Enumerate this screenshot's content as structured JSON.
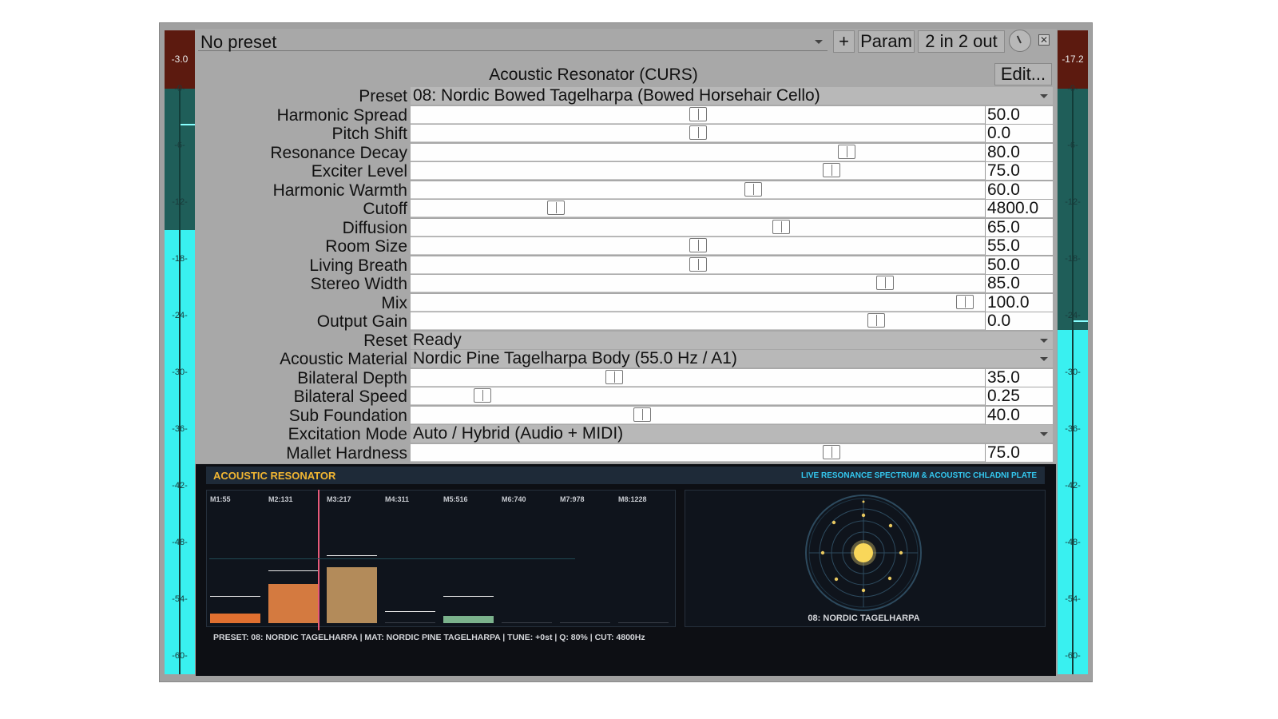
{
  "topbar": {
    "preset_selector": "No preset",
    "add_label": "+",
    "param_label": "Param",
    "io_label": "2 in 2 out",
    "close_icon": "close-icon",
    "knob_icon": "dial-icon"
  },
  "plugin": {
    "title": "Acoustic Resonator (CURS)",
    "edit_label": "Edit..."
  },
  "meters": {
    "left_peak": "-3.0",
    "right_peak": "-17.2",
    "scale": [
      "-0-",
      "-6-",
      "-12-",
      "-18-",
      "-24-",
      "-30-",
      "-36-",
      "-42-",
      "-48-",
      "-54-",
      "-60-"
    ],
    "left_level": 0.69,
    "right_level": 0.535,
    "left_hold": 0.855,
    "right_hold": 0.55,
    "fill_color": "#39f0f0",
    "dark_color": "#1f5e59",
    "clip_color": "#5c1a0f"
  },
  "params": [
    {
      "type": "combo",
      "label": "Preset",
      "value": "08: Nordic Bowed Tagelharpa (Bowed Horsehair Cello)"
    },
    {
      "type": "slider",
      "label": "Harmonic Spread",
      "value": "50.0",
      "pos": 0.5
    },
    {
      "type": "slider",
      "label": "Pitch Shift",
      "value": "0.0",
      "pos": 0.5
    },
    {
      "type": "slider",
      "label": "Resonance Decay",
      "value": "80.0",
      "pos": 0.767
    },
    {
      "type": "slider",
      "label": "Exciter Level",
      "value": "75.0",
      "pos": 0.741
    },
    {
      "type": "slider",
      "label": "Harmonic Warmth",
      "value": "60.0",
      "pos": 0.6
    },
    {
      "type": "slider",
      "label": "Cutoff",
      "value": "4800.0",
      "pos": 0.246
    },
    {
      "type": "slider",
      "label": "Diffusion",
      "value": "65.0",
      "pos": 0.65
    },
    {
      "type": "slider",
      "label": "Room Size",
      "value": "55.0",
      "pos": 0.5
    },
    {
      "type": "slider",
      "label": "Living Breath",
      "value": "50.0",
      "pos": 0.5
    },
    {
      "type": "slider",
      "label": "Stereo Width",
      "value": "85.0",
      "pos": 0.836
    },
    {
      "type": "slider",
      "label": "Mix",
      "value": "100.0",
      "pos": 0.98
    },
    {
      "type": "slider",
      "label": "Output Gain",
      "value": "0.0",
      "pos": 0.82
    },
    {
      "type": "combo",
      "label": "Reset",
      "value": "Ready"
    },
    {
      "type": "combo",
      "label": "Acoustic Material",
      "value": "Nordic Pine Tagelharpa Body (55.0 Hz / A1)"
    },
    {
      "type": "slider",
      "label": "Bilateral Depth",
      "value": "35.0",
      "pos": 0.35
    },
    {
      "type": "slider",
      "label": "Bilateral Speed",
      "value": "0.25",
      "pos": 0.114
    },
    {
      "type": "slider",
      "label": "Sub Foundation",
      "value": "40.0",
      "pos": 0.4
    },
    {
      "type": "combo",
      "label": "Excitation Mode",
      "value": "Auto / Hybrid (Audio + MIDI)"
    },
    {
      "type": "slider",
      "label": "Mallet Hardness",
      "value": "75.0",
      "pos": 0.741
    }
  ],
  "viz": {
    "title": "ACOUSTIC RESONATOR",
    "subtitle": "LIVE RESONANCE SPECTRUM & ACOUSTIC CHLADNI PLATE",
    "modes": [
      {
        "label": "M1:55",
        "level": 0.07,
        "peak": 0.2,
        "color": "#e07030"
      },
      {
        "label": "M2:131",
        "level": 0.29,
        "peak": 0.39,
        "color": "#d47a40"
      },
      {
        "label": "M3:217",
        "level": 0.41,
        "peak": 0.5,
        "color": "#b38b5a"
      },
      {
        "label": "M4:311",
        "level": 0.0,
        "peak": 0.09,
        "color": "#7a7a7a"
      },
      {
        "label": "M5:516",
        "level": 0.05,
        "peak": 0.2,
        "color": "#7bb28c"
      },
      {
        "label": "M6:740",
        "level": 0.0,
        "peak": 0.0,
        "color": "#7a7a7a"
      },
      {
        "label": "M7:978",
        "level": 0.0,
        "peak": 0.0,
        "color": "#7a7a7a"
      },
      {
        "label": "M8:1228",
        "level": 0.0,
        "peak": 0.0,
        "color": "#7a7a7a"
      }
    ],
    "cursor_color": "#e85a7a",
    "plate_name": "08: NORDIC TAGELHARPA",
    "status": "PRESET: 08: NORDIC TAGELHARPA  |  MAT: NORDIC PINE TAGELHARPA  |  TUNE: +0st  |  Q: 80%  |  CUT: 4800Hz"
  }
}
